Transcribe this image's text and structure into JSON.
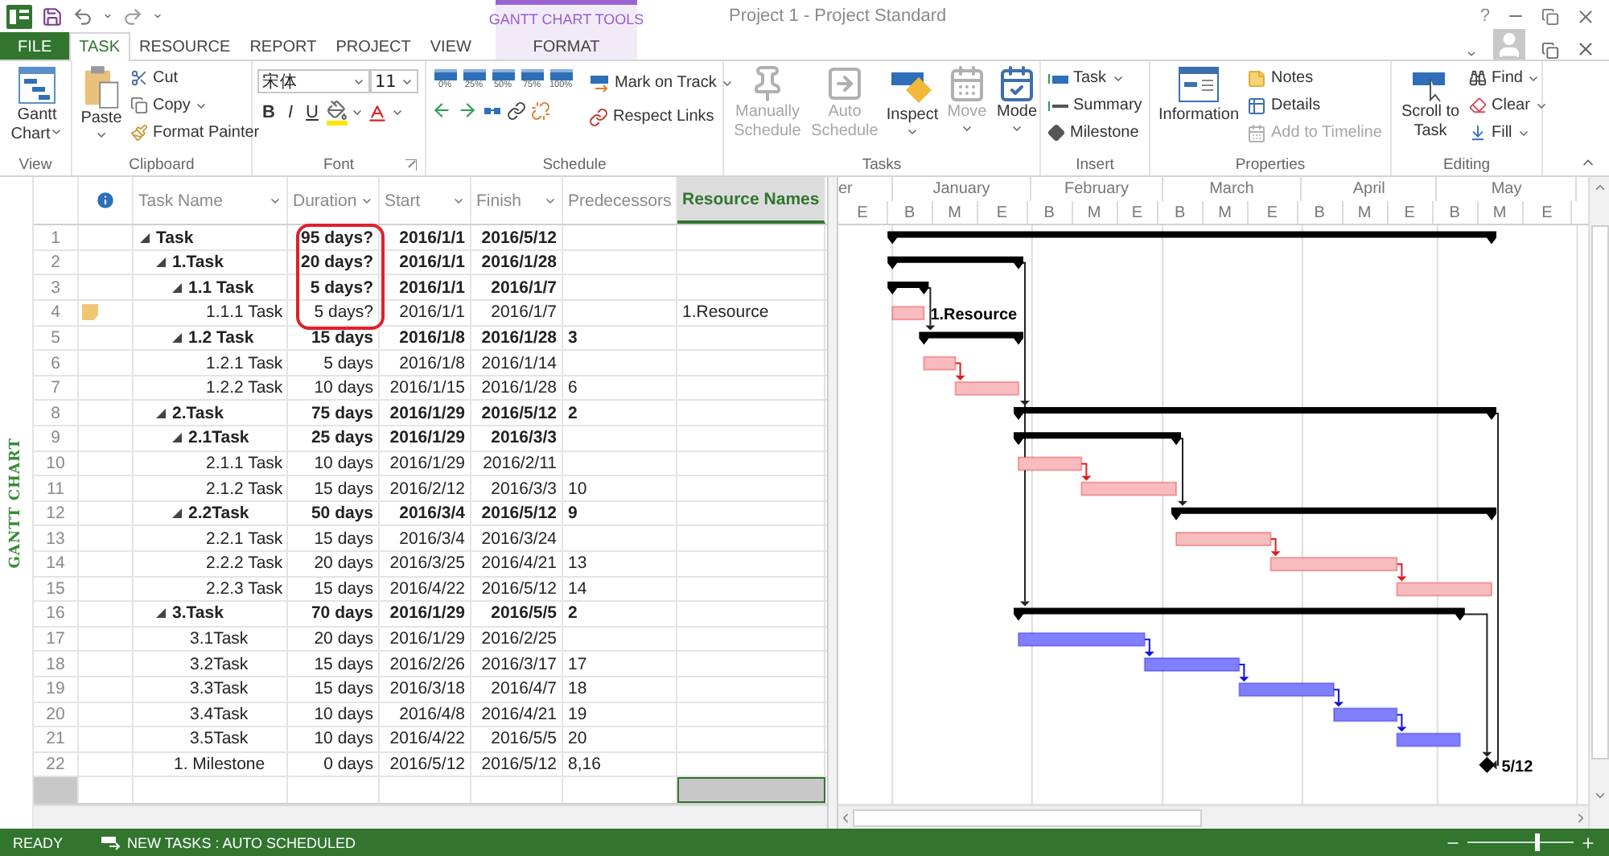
{
  "title_bar": {
    "title": "Project 1 - Project Standard",
    "context_group": "GANTT CHART TOOLS",
    "help": "?"
  },
  "tabs": [
    {
      "label": "FILE",
      "kind": "file",
      "selected": false
    },
    {
      "label": "TASK",
      "kind": "plain",
      "selected": true
    },
    {
      "label": "RESOURCE",
      "kind": "plain",
      "selected": false
    },
    {
      "label": "REPORT",
      "kind": "plain",
      "selected": false
    },
    {
      "label": "PROJECT",
      "kind": "plain",
      "selected": false
    },
    {
      "label": "VIEW",
      "kind": "plain",
      "selected": false
    },
    {
      "label": "FORMAT",
      "kind": "context",
      "selected": false
    }
  ],
  "ribbon": {
    "groups": [
      {
        "label": "View",
        "items": [
          {
            "label": "Gantt Chart",
            "dropdown": true
          }
        ]
      },
      {
        "label": "Clipboard",
        "items": [
          {
            "label": "Paste",
            "dropdown": true
          },
          {
            "label": "Cut",
            "dropdown": false
          },
          {
            "label": "Copy",
            "dropdown": true
          },
          {
            "label": "Format Painter",
            "dropdown": false
          }
        ]
      },
      {
        "label": "Font",
        "font_name": "宋体",
        "font_size": "11",
        "items": [
          {
            "label": "B"
          },
          {
            "label": "I"
          },
          {
            "label": "U"
          }
        ]
      },
      {
        "label": "Schedule",
        "percents": [
          "0%",
          "25%",
          "50%",
          "75%",
          "100%"
        ],
        "items": [
          {
            "label": "Mark on Track",
            "dropdown": true
          },
          {
            "label": "Respect Links",
            "dropdown": false
          }
        ]
      },
      {
        "label": "Tasks",
        "items": [
          {
            "label": "Manually Schedule",
            "dropdown": false,
            "disabled": true
          },
          {
            "label": "Auto Schedule",
            "dropdown": false,
            "disabled": true
          },
          {
            "label": "Inspect",
            "dropdown": true,
            "disabled": false
          },
          {
            "label": "Move",
            "dropdown": true,
            "disabled": true
          },
          {
            "label": "Mode",
            "dropdown": true,
            "disabled": false
          }
        ]
      },
      {
        "label": "Insert",
        "items": [
          {
            "label": "Task",
            "dropdown": true
          },
          {
            "label": "Summary",
            "dropdown": false
          },
          {
            "label": "Milestone",
            "dropdown": false
          }
        ]
      },
      {
        "label": "Properties",
        "items": [
          {
            "label": "Information",
            "disabled": false
          },
          {
            "label": "Notes",
            "disabled": false
          },
          {
            "label": "Details",
            "disabled": false
          },
          {
            "label": "Add to Timeline",
            "disabled": true
          }
        ]
      },
      {
        "label": "Editing",
        "items": [
          {
            "label": "Scroll to Task",
            "dropdown": false
          },
          {
            "label": "Find",
            "dropdown": true
          },
          {
            "label": "Clear",
            "dropdown": true
          },
          {
            "label": "Fill",
            "dropdown": true
          }
        ]
      }
    ]
  },
  "view_bar": {
    "label": "GANTT CHART"
  },
  "table": {
    "columns": [
      {
        "label": "Task Name",
        "selected": false
      },
      {
        "label": "Duration",
        "selected": false
      },
      {
        "label": "Start",
        "selected": false
      },
      {
        "label": "Finish",
        "selected": false
      },
      {
        "label": "Predecessors",
        "selected": false
      },
      {
        "label": "Resource Names",
        "selected": true
      }
    ],
    "rows": [
      {
        "id": "1",
        "name": "Task",
        "kind": "summary",
        "expanded": true,
        "note": false,
        "circled": true,
        "duration": "95 days?",
        "start": "2016/1/1",
        "finish": "2016/5/12",
        "children": [
          {
            "id": "2",
            "name": "1.Task",
            "kind": "summary",
            "expanded": true,
            "note": false,
            "circled": true,
            "duration": "20 days?",
            "start": "2016/1/1",
            "finish": "2016/1/28",
            "children": [
              {
                "id": "3",
                "name": "1.1 Task",
                "kind": "summary",
                "expanded": true,
                "note": false,
                "circled": true,
                "duration": "5 days?",
                "start": "2016/1/1",
                "finish": "2016/1/7",
                "children": [
                  {
                    "id": "4",
                    "name": "1.1.1 Task",
                    "kind": "task",
                    "note": true,
                    "circled": true,
                    "duration": "5 days?",
                    "start": "2016/1/1",
                    "finish": "2016/1/7",
                    "resource": "1.Resource",
                    "bar_label": "1.Resource",
                    "color": "#f9bcbe"
                  }
                ]
              },
              {
                "id": "5",
                "name": "1.2 Task",
                "kind": "summary",
                "expanded": true,
                "note": false,
                "circled": false,
                "duration": "15 days",
                "start": "2016/1/8",
                "finish": "2016/1/28",
                "predecessors": "3",
                "children": [
                  {
                    "id": "6",
                    "name": "1.2.1 Task",
                    "kind": "task",
                    "note": false,
                    "circled": false,
                    "duration": "5 days",
                    "start": "2016/1/8",
                    "finish": "2016/1/14",
                    "color": "#f9bcbe"
                  },
                  {
                    "id": "7",
                    "name": "1.2.2 Task",
                    "kind": "task",
                    "note": false,
                    "circled": false,
                    "duration": "10 days",
                    "start": "2016/1/15",
                    "finish": "2016/1/28",
                    "predecessors": "6",
                    "color": "#f9bcbe"
                  }
                ]
              }
            ]
          },
          {
            "id": "8",
            "name": "2.Task",
            "kind": "summary",
            "expanded": true,
            "note": false,
            "circled": false,
            "duration": "75 days",
            "start": "2016/1/29",
            "finish": "2016/5/12",
            "predecessors": "2",
            "children": [
              {
                "id": "9",
                "name": "2.1Task",
                "kind": "summary",
                "expanded": true,
                "note": false,
                "circled": false,
                "duration": "25 days",
                "start": "2016/1/29",
                "finish": "2016/3/3",
                "children": [
                  {
                    "id": "10",
                    "name": "2.1.1 Task",
                    "kind": "task",
                    "note": false,
                    "circled": false,
                    "duration": "10 days",
                    "start": "2016/1/29",
                    "finish": "2016/2/11",
                    "color": "#f9bcbe"
                  },
                  {
                    "id": "11",
                    "name": "2.1.2 Task",
                    "kind": "task",
                    "note": false,
                    "circled": false,
                    "duration": "15 days",
                    "start": "2016/2/12",
                    "finish": "2016/3/3",
                    "predecessors": "10",
                    "color": "#f9bcbe"
                  }
                ]
              },
              {
                "id": "12",
                "name": "2.2Task",
                "kind": "summary",
                "expanded": true,
                "note": false,
                "circled": false,
                "duration": "50 days",
                "start": "2016/3/4",
                "finish": "2016/5/12",
                "predecessors": "9",
                "children": [
                  {
                    "id": "13",
                    "name": "2.2.1 Task",
                    "kind": "task",
                    "note": false,
                    "circled": false,
                    "duration": "15 days",
                    "start": "2016/3/4",
                    "finish": "2016/3/24",
                    "color": "#f9bcbe"
                  },
                  {
                    "id": "14",
                    "name": "2.2.2 Task",
                    "kind": "task",
                    "note": false,
                    "circled": false,
                    "duration": "20 days",
                    "start": "2016/3/25",
                    "finish": "2016/4/21",
                    "predecessors": "13",
                    "color": "#f9bcbe"
                  },
                  {
                    "id": "15",
                    "name": "2.2.3 Task",
                    "kind": "task",
                    "note": false,
                    "circled": false,
                    "duration": "15 days",
                    "start": "2016/4/22",
                    "finish": "2016/5/12",
                    "predecessors": "14",
                    "color": "#f9bcbe"
                  }
                ]
              }
            ]
          },
          {
            "id": "16",
            "name": "3.Task",
            "kind": "summary",
            "expanded": true,
            "note": false,
            "circled": false,
            "duration": "70 days",
            "start": "2016/1/29",
            "finish": "2016/5/5",
            "predecessors": "2",
            "children": [
              {
                "id": "17",
                "name": "3.1Task",
                "kind": "task",
                "note": false,
                "circled": false,
                "duration": "20 days",
                "start": "2016/1/29",
                "finish": "2016/2/25",
                "color": "#8080ff"
              },
              {
                "id": "18",
                "name": "3.2Task",
                "kind": "task",
                "note": false,
                "circled": false,
                "duration": "15 days",
                "start": "2016/2/26",
                "finish": "2016/3/17",
                "predecessors": "17",
                "color": "#8080ff"
              },
              {
                "id": "19",
                "name": "3.3Task",
                "kind": "task",
                "note": false,
                "circled": false,
                "duration": "15 days",
                "start": "2016/3/18",
                "finish": "2016/4/7",
                "predecessors": "18",
                "color": "#8080ff"
              },
              {
                "id": "20",
                "name": "3.4Task",
                "kind": "task",
                "note": false,
                "circled": false,
                "duration": "10 days",
                "start": "2016/4/8",
                "finish": "2016/4/21",
                "predecessors": "19",
                "color": "#8080ff"
              },
              {
                "id": "21",
                "name": "3.5Task",
                "kind": "task",
                "note": false,
                "circled": false,
                "duration": "10 days",
                "start": "2016/4/22",
                "finish": "2016/5/5",
                "predecessors": "20",
                "color": "#8080ff"
              }
            ]
          },
          {
            "id": "22",
            "name": "1. Milestone",
            "kind": "milestone",
            "note": false,
            "circled": false,
            "duration": "0 days",
            "start": "2016/5/12",
            "finish": "2016/5/12",
            "predecessors": "8,16",
            "bar_label": "5/12"
          }
        ]
      }
    ]
  },
  "timescale": {
    "months": [
      {
        "label": "er",
        "thirds": [
          "E"
        ]
      },
      {
        "label": "January",
        "thirds": [
          "B",
          "M",
          "E"
        ]
      },
      {
        "label": "February",
        "thirds": [
          "B",
          "M",
          "E"
        ]
      },
      {
        "label": "March",
        "thirds": [
          "B",
          "M",
          "E"
        ]
      },
      {
        "label": "April",
        "thirds": [
          "B",
          "M",
          "E"
        ]
      },
      {
        "label": "May",
        "thirds": [
          "B",
          "M",
          "E"
        ]
      }
    ]
  },
  "status_bar": {
    "ready": "READY",
    "new_tasks": "NEW TASKS : AUTO SCHEDULED",
    "zoom": {
      "level": 0.65
    }
  }
}
